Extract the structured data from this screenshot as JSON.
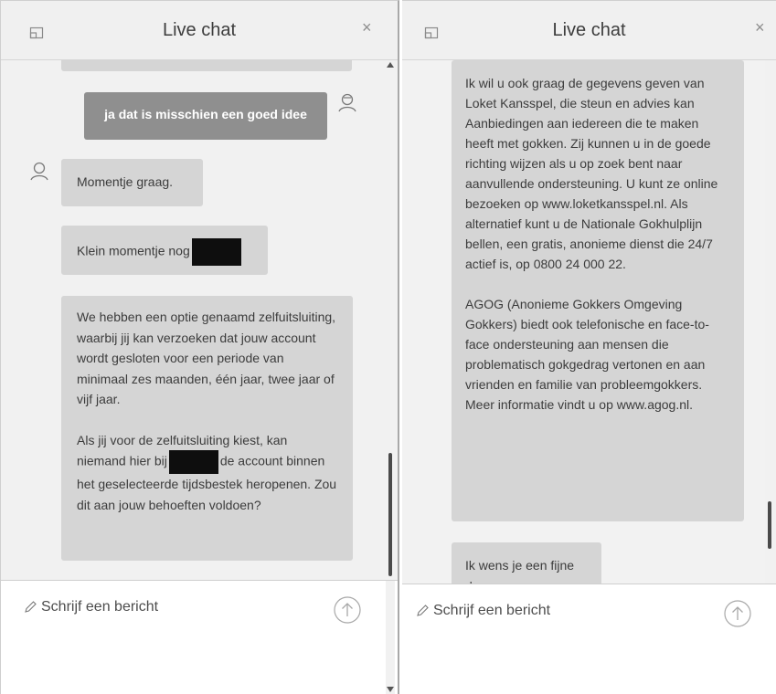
{
  "left_panel": {
    "title": "Live chat",
    "close_icon": "×",
    "messages": {
      "user_reply": "ja dat is misschien een goed idee",
      "agent_1": "Momentje graag.",
      "agent_2": "Klein momentje nog",
      "agent_3_p1": "We hebben een optie genaamd zelfuitsluiting, waarbij jij kan verzoeken dat jouw account wordt gesloten voor een periode van minimaal zes maanden, één jaar, twee jaar of vijf jaar.",
      "agent_3_p2_a": "Als jij voor de zelfuitsluiting kiest, kan niemand hier bij",
      "agent_3_p2_b": "de account binnen het geselecteerde tijdsbestek heropenen. Zou dit aan jouw behoeften voldoen?"
    },
    "composer_placeholder": "Schrijf een bericht"
  },
  "right_panel": {
    "title": "Live chat",
    "close_icon": "×",
    "messages": {
      "agent_p1": "Ik wil u ook graag de gegevens geven van Loket Kansspel, die steun en advies kan Aanbiedingen aan iedereen die te maken heeft met gokken. Zij kunnen u in de goede richting wijzen als u op zoek bent naar aanvullende ondersteuning. U kunt ze online bezoeken op www.loketkansspel.nl. Als alternatief kunt u de Nationale Gokhulplijn bellen, een gratis, anonieme dienst die 24/7 actief is, op 0800 24 000 22.",
      "agent_p2": "AGOG (Anonieme Gokkers Omgeving Gokkers) biedt ook telefonische en face-to-face ondersteuning aan mensen die problematisch gokgedrag vertonen en aan vrienden en familie van probleemgokkers. Meer informatie vindt u op www.agog.nl.",
      "agent_last": "Ik wens je een fijne dag."
    },
    "composer_placeholder": "Schrijf een bericht"
  },
  "colors": {
    "agent_bubble": "#d5d5d5",
    "user_bubble": "#8f8f8f",
    "redaction": "#0e0e0e"
  },
  "icons": [
    "popout-icon",
    "close-icon",
    "user-avatar-icon",
    "agent-avatar-icon",
    "pencil-icon",
    "send-arrow-icon",
    "scroll-up-arrow-icon",
    "scroll-down-arrow-icon"
  ]
}
